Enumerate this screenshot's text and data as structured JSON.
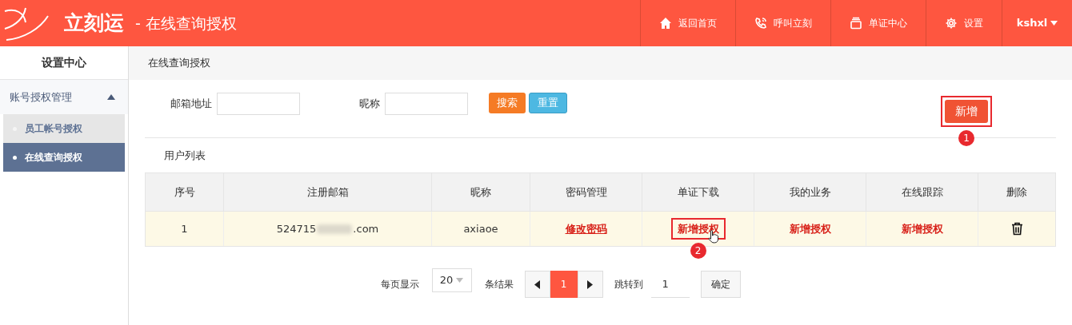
{
  "header": {
    "logo_text": "立刻运",
    "page_title": "- 在线查询授权",
    "nav": [
      {
        "kind": "home",
        "label": "返回首页"
      },
      {
        "kind": "phone",
        "label": "呼叫立刻"
      },
      {
        "kind": "documents",
        "label": "单证中心"
      },
      {
        "kind": "settings",
        "label": "设置"
      }
    ],
    "user": {
      "name": "kshxl"
    }
  },
  "sidebar": {
    "title": "设置中心",
    "groups": [
      {
        "label": "账号授权管理",
        "expanded": true,
        "children": [
          {
            "label": "员工帐号授权",
            "selected": false
          },
          {
            "label": "在线查询授权",
            "selected": true
          }
        ]
      }
    ]
  },
  "breadcrumb": "在线查询授权",
  "filters": [
    {
      "label": "邮箱地址"
    },
    {
      "label": "昵称"
    }
  ],
  "search_button": "搜索",
  "reset_button": "重置",
  "add_button": {
    "label": "新增",
    "highlighted": true,
    "step": "1"
  },
  "table": {
    "title": "用户列表",
    "columns": [
      "序号",
      "注册邮箱",
      "昵称",
      "密码管理",
      "单证下载",
      "我的业务",
      "在线跟踪",
      "删除"
    ],
    "rows": [
      {
        "index": "1",
        "email_start": "524715",
        "email_end": ".com",
        "email_blurred": true,
        "nickname": "axiaoe",
        "password_link": "修改密码",
        "download": {
          "label": "新增授权",
          "highlighted": true,
          "step": "2",
          "cursor": true
        },
        "business": {
          "label": "新增授权"
        },
        "tracking": {
          "label": "新增授权"
        }
      }
    ]
  },
  "pagination": {
    "page_size_label": "每页显示",
    "page_size": "20",
    "results_label": "条结果",
    "pages": [
      {
        "label": "1",
        "selected": true
      }
    ],
    "jump_label": "跳转到",
    "jump_value": "1",
    "confirm": "确定"
  }
}
